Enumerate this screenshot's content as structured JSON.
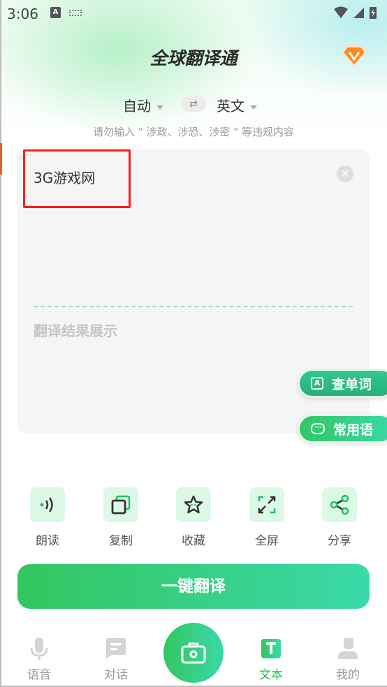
{
  "status_bar": {
    "time": "3:06",
    "icons": [
      "a-notification-icon",
      "keyboard-icon",
      "wifi-icon",
      "signal-icon",
      "battery-charging-icon"
    ]
  },
  "header": {
    "title": "全球翻译通",
    "vip_icon": "vip-diamond-icon"
  },
  "languages": {
    "source": "自动",
    "target": "英文",
    "swap_icon": "swap-icon"
  },
  "notice": "请勿输入 \" 涉政、涉恐、涉密 \" 等违规内容",
  "input": {
    "value": "3G游戏网",
    "clear_icon": "close-icon"
  },
  "result": {
    "placeholder": "翻译结果展示"
  },
  "floating": {
    "lookup": "查单词",
    "phrases": "常用语"
  },
  "actions": [
    {
      "label": "朗读",
      "icon": "speaker-icon"
    },
    {
      "label": "复制",
      "icon": "copy-icon"
    },
    {
      "label": "收藏",
      "icon": "star-icon"
    },
    {
      "label": "全屏",
      "icon": "fullscreen-icon"
    },
    {
      "label": "分享",
      "icon": "share-icon"
    }
  ],
  "translate_button": "一键翻译",
  "nav": [
    {
      "label": "语音",
      "icon": "microphone-icon"
    },
    {
      "label": "对话",
      "icon": "chat-icon"
    },
    {
      "label": "",
      "icon": "camera-icon"
    },
    {
      "label": "文本",
      "icon": "text-icon",
      "active": true
    },
    {
      "label": "我的",
      "icon": "user-icon"
    }
  ],
  "colors": {
    "accent": "#33c65f",
    "accent2": "#3ad9a9",
    "inactive": "#999999",
    "highlight_box": "#ff1c1c"
  }
}
